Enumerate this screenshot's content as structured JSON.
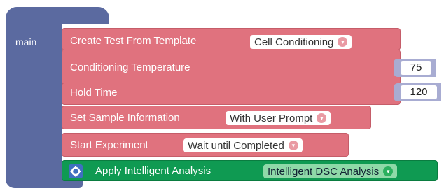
{
  "main_block": {
    "label": "main",
    "color": "#5b6aa0"
  },
  "blocks": {
    "create_test": {
      "label": "Create Test From Template",
      "dropdown": "Cell Conditioning",
      "color": "#e0727e"
    },
    "conditioning_temperature": {
      "label": "Conditioning Temperature",
      "value": "75"
    },
    "hold_time": {
      "label": "Hold Time",
      "value": "120"
    },
    "set_sample": {
      "label": "Set Sample Information",
      "dropdown": "With User Prompt"
    },
    "start_experiment": {
      "label": "Start Experiment",
      "dropdown": "Wait until Completed"
    },
    "apply_analysis": {
      "label": "Apply Intelligent Analysis",
      "dropdown": "Intelligent DSC Analysis",
      "color": "#0f9a52",
      "icon": "gear-icon"
    }
  }
}
